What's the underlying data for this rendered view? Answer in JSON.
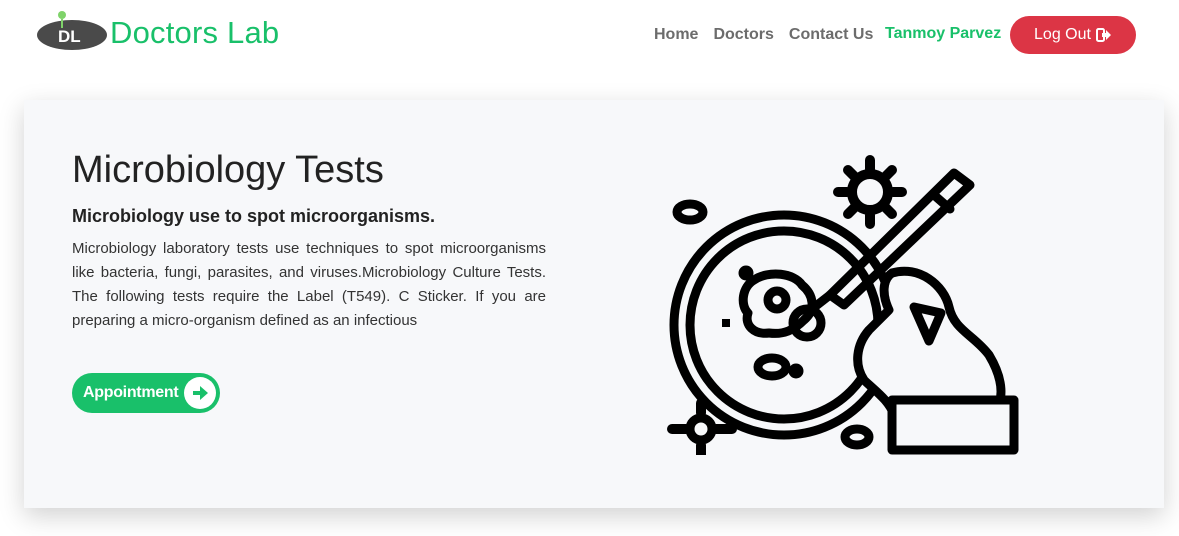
{
  "navbar": {
    "brand": "Doctors Lab",
    "logo_letters": "DL",
    "links": [
      "Home",
      "Doctors",
      "Contact Us"
    ],
    "user_name": "Tanmoy Parvez",
    "logout_label": "Log Out",
    "logout_icon": "sign-out-icon"
  },
  "hero": {
    "title": "Microbiology Tests",
    "subtitle": "Microbiology use to spot microorganisms.",
    "description": "Microbiology laboratory tests use techniques to spot microorganisms like bacteria, fungi, parasites, and viruses.Microbiology Culture Tests. The following tests require the Label (T549). C Sticker. If you are preparing a micro-organism defined as an infectious",
    "button_label": "Appointment",
    "button_icon": "arrow-circle-right-icon",
    "illustration": "petri-dish-microscope-icon"
  },
  "colors": {
    "brand_green": "#19c06a",
    "logout_red": "#dc3545",
    "card_bg": "#f7f8fa"
  }
}
